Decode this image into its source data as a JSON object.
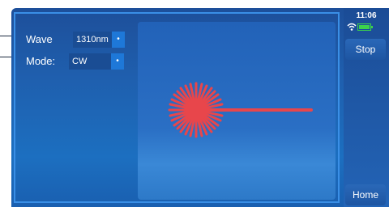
{
  "status": {
    "time": "11:06"
  },
  "settings": {
    "wave": {
      "label": "Wave",
      "value": "1310nm"
    },
    "mode": {
      "label": "Mode:",
      "value": "CW"
    }
  },
  "sidebar": {
    "stop_label": "Stop",
    "home_label": "Home"
  },
  "display": {
    "icon": "laser-beam-icon"
  },
  "colors": {
    "laser": "#e8464b",
    "battery": "#3cd24b",
    "background": "#1f5fae"
  }
}
